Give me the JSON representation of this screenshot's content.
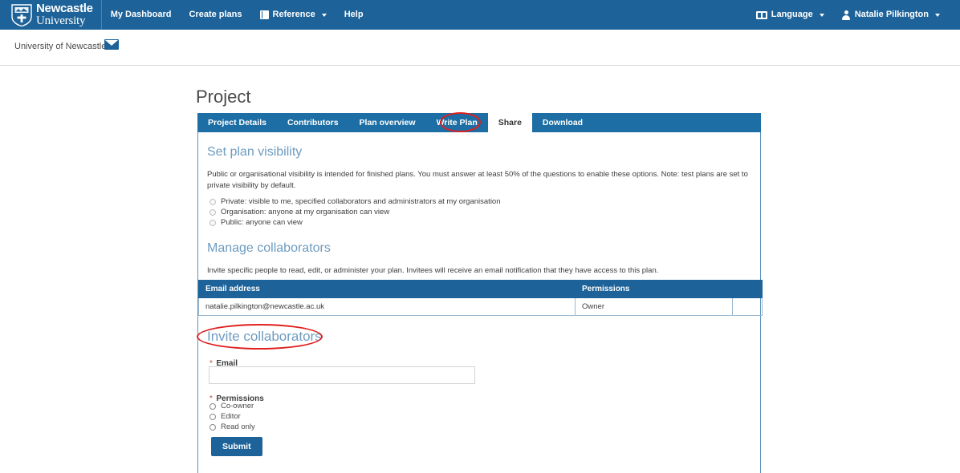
{
  "navbar": {
    "brand": {
      "line1": "Newcastle",
      "line2": "University",
      "crest_icon": "shield-crest-icon"
    },
    "links": [
      {
        "label": "My Dashboard",
        "icon": null,
        "caret": false
      },
      {
        "label": "Create plans",
        "icon": null,
        "caret": false
      },
      {
        "label": "Reference",
        "icon": "book-icon",
        "caret": true
      },
      {
        "label": "Help",
        "icon": null,
        "caret": false
      }
    ],
    "right": [
      {
        "label": "Language",
        "icon": "language-icon",
        "caret": true
      },
      {
        "label": "Natalie Pilkington",
        "icon": "user-icon",
        "caret": true
      }
    ]
  },
  "orgbar": {
    "organisation": "University of Newcastle",
    "envelope_icon": "envelope-icon"
  },
  "page": {
    "title": "Project"
  },
  "tabs": [
    {
      "label": "Project Details",
      "active": false
    },
    {
      "label": "Contributors",
      "active": false
    },
    {
      "label": "Plan overview",
      "active": false
    },
    {
      "label": "Write Plan",
      "active": false
    },
    {
      "label": "Share",
      "active": true
    },
    {
      "label": "Download",
      "active": false
    }
  ],
  "visibility": {
    "heading": "Set plan visibility",
    "description": "Public or organisational visibility is intended for finished plans. You must answer at least 50% of the questions to enable these options. Note: test plans are set to private visibility by default.",
    "options": [
      {
        "label": "Private: visible to me, specified collaborators and administrators at my organisation",
        "selected": false,
        "disabled": true
      },
      {
        "label": "Organisation: anyone at my organisation can view",
        "selected": false,
        "disabled": true
      },
      {
        "label": "Public: anyone can view",
        "selected": false,
        "disabled": true
      }
    ]
  },
  "manage": {
    "heading": "Manage collaborators",
    "description": "Invite specific people to read, edit, or administer your plan. Invitees will receive an email notification that they have access to this plan.",
    "columns": [
      "Email address",
      "Permissions",
      ""
    ],
    "rows": [
      {
        "email": "natalie.pilkington@newcastle.ac.uk",
        "permissions": "Owner",
        "action": ""
      }
    ]
  },
  "invite": {
    "heading": "Invite collaborators",
    "email_label": "Email",
    "email_required_marker": "*",
    "email_value": "",
    "email_placeholder": "",
    "permissions_label": "Permissions",
    "permissions_required_marker": "*",
    "permissions_options": [
      {
        "label": "Co-owner",
        "selected": false
      },
      {
        "label": "Editor",
        "selected": false
      },
      {
        "label": "Read only",
        "selected": false
      }
    ],
    "submit_label": "Submit"
  },
  "annotations": [
    {
      "name": "share-tab-highlight",
      "shape": "ellipse",
      "color": "#e01f1f"
    },
    {
      "name": "invite-collaborators-highlight",
      "shape": "ellipse",
      "color": "#e01f1f"
    }
  ],
  "colors": {
    "navbar_blue": "#1d6298",
    "tabbar_blue": "#1c6ea4",
    "heading_blue": "#6e9cc0",
    "annotation_red": "#e01f1f",
    "required_red": "#b94a48"
  }
}
